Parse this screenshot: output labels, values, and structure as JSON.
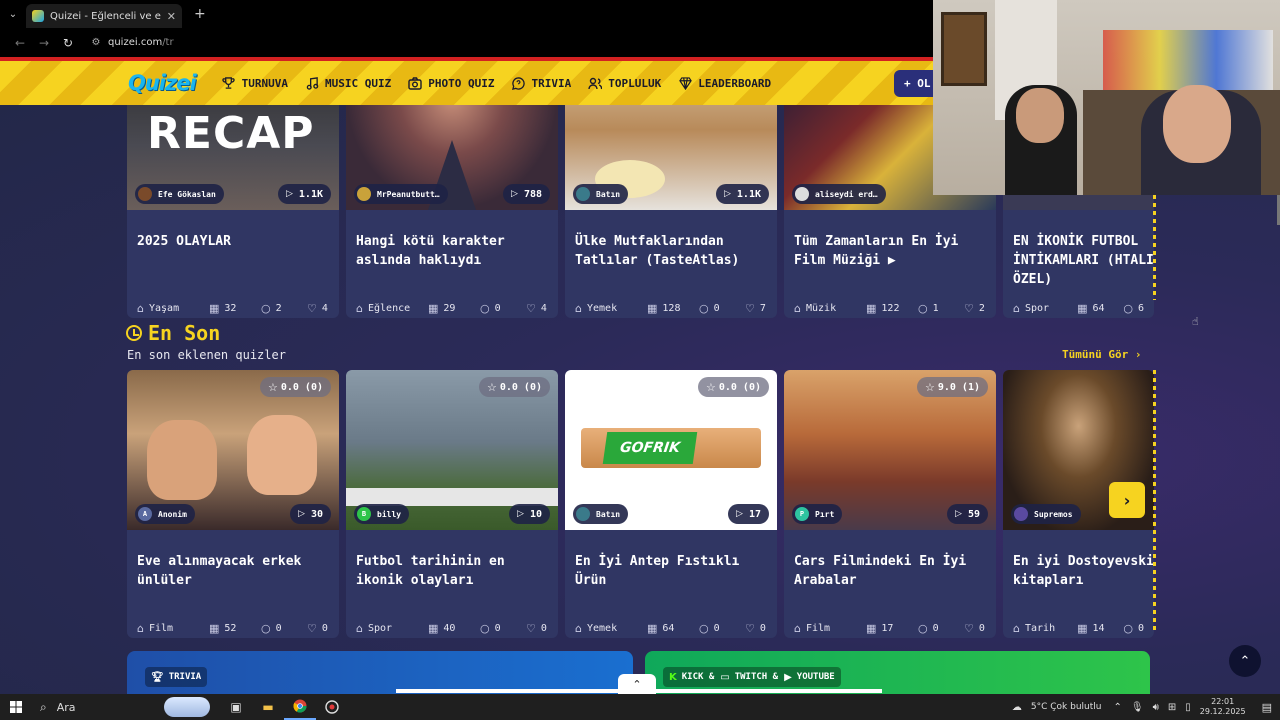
{
  "browser": {
    "tab_title": "Quizei - Eğlenceli ve etkileşimli",
    "url_host": "quizei.com",
    "url_path": "/tr"
  },
  "header": {
    "logo": "Quizei",
    "menu": [
      {
        "label": "TURNUVA",
        "icon": "trophy-icon"
      },
      {
        "label": "MUSIC QUIZ",
        "icon": "music-note-icon"
      },
      {
        "label": "PHOTO QUIZ",
        "icon": "camera-icon"
      },
      {
        "label": "TRIVIA",
        "icon": "question-bubble-icon"
      },
      {
        "label": "TOPLULUK",
        "icon": "users-icon"
      },
      {
        "label": "LEADERBOARD",
        "icon": "award-icon"
      }
    ],
    "create_label": "+ OL"
  },
  "row1": [
    {
      "author": "Efe Gökaslan",
      "plays": "1.1K",
      "title": "2025 OLAYLAR",
      "category": "Yaşam",
      "questions": "32",
      "comments": "2",
      "likes": "4",
      "thumb_text": "RECAP"
    },
    {
      "author": "MrPeanutbutt…",
      "plays": "788",
      "title": "Hangi kötü karakter aslında haklıydı",
      "category": "Eğlence",
      "questions": "29",
      "comments": "0",
      "likes": "4"
    },
    {
      "author": "Batın",
      "plays": "1.1K",
      "title": "Ülke Mutfaklarından Tatlılar (TasteAtlas)",
      "category": "Yemek",
      "questions": "128",
      "comments": "0",
      "likes": "7"
    },
    {
      "author": "aliseydi erd…",
      "plays": "",
      "title": "Tüm Zamanların En İyi Film Müziği ▶",
      "category": "Müzik",
      "questions": "122",
      "comments": "1",
      "likes": "2"
    },
    {
      "author": "",
      "plays": "",
      "title": "EN İKONİK FUTBOL İNTİKAMLARI (HTALI ÖZEL)",
      "category": "Spor",
      "questions": "64",
      "comments": "6",
      "likes": ""
    }
  ],
  "section": {
    "title": "En Son",
    "subtitle": "En son eklenen quizler",
    "see_all": "Tümünü Gör ›"
  },
  "row2": [
    {
      "author": "Anonim",
      "avatar_letter": "A",
      "plays": "30",
      "rating": "0.0 (0)",
      "title": "Eve alınmayacak erkek ünlüler",
      "category": "Film",
      "questions": "52",
      "comments": "0",
      "likes": "0"
    },
    {
      "author": "billy",
      "avatar_letter": "B",
      "plays": "10",
      "rating": "0.0 (0)",
      "title": "Futbol tarihinin en ikonik olayları",
      "category": "Spor",
      "questions": "40",
      "comments": "0",
      "likes": "0"
    },
    {
      "author": "Batın",
      "avatar_letter": "",
      "plays": "17",
      "rating": "0.0 (0)",
      "title": "En İyi Antep Fıstıklı Ürün",
      "category": "Yemek",
      "questions": "64",
      "comments": "0",
      "likes": "0",
      "thumb_text": "GOFRIK"
    },
    {
      "author": "Pırt",
      "avatar_letter": "P",
      "plays": "59",
      "rating": "9.0 (1)",
      "title": "Cars Filmindeki En İyi Arabalar",
      "category": "Film",
      "questions": "17",
      "comments": "0",
      "likes": "0"
    },
    {
      "author": "Supremos",
      "avatar_letter": "",
      "plays": "",
      "rating": "",
      "title": "En iyi Dostoyevski kitapları",
      "category": "Tarih",
      "questions": "14",
      "comments": "0",
      "likes": ""
    }
  ],
  "banners": {
    "left_tag": "TRIVIA",
    "right_tag_1": "KICK &",
    "right_tag_2": "TWITCH &",
    "right_tag_3": "YOUTUBE"
  },
  "taskbar": {
    "search_label": "Ara",
    "weather": "5°C  Çok bulutlu",
    "time": "22:01",
    "date": "29.12.2025"
  },
  "colors": {
    "accent": "#f6d320",
    "card_bg": "#303663",
    "page_bg": "#232849"
  }
}
